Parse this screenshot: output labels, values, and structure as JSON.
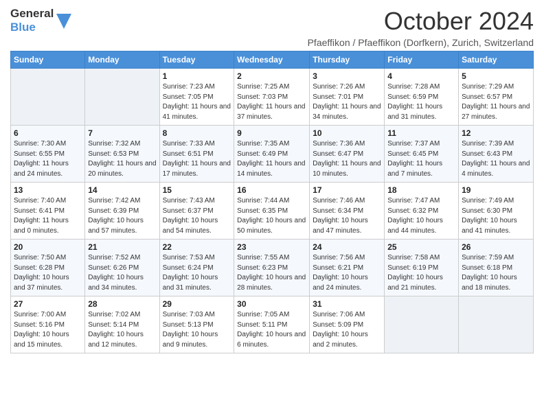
{
  "header": {
    "logo_general": "General",
    "logo_blue": "Blue",
    "title": "October 2024",
    "subtitle": "Pfaeffikon / Pfaeffikon (Dorfkern), Zurich, Switzerland"
  },
  "weekdays": [
    "Sunday",
    "Monday",
    "Tuesday",
    "Wednesday",
    "Thursday",
    "Friday",
    "Saturday"
  ],
  "weeks": [
    [
      {
        "day": "",
        "sunrise": "",
        "sunset": "",
        "daylight": ""
      },
      {
        "day": "",
        "sunrise": "",
        "sunset": "",
        "daylight": ""
      },
      {
        "day": "1",
        "sunrise": "Sunrise: 7:23 AM",
        "sunset": "Sunset: 7:05 PM",
        "daylight": "Daylight: 11 hours and 41 minutes."
      },
      {
        "day": "2",
        "sunrise": "Sunrise: 7:25 AM",
        "sunset": "Sunset: 7:03 PM",
        "daylight": "Daylight: 11 hours and 37 minutes."
      },
      {
        "day": "3",
        "sunrise": "Sunrise: 7:26 AM",
        "sunset": "Sunset: 7:01 PM",
        "daylight": "Daylight: 11 hours and 34 minutes."
      },
      {
        "day": "4",
        "sunrise": "Sunrise: 7:28 AM",
        "sunset": "Sunset: 6:59 PM",
        "daylight": "Daylight: 11 hours and 31 minutes."
      },
      {
        "day": "5",
        "sunrise": "Sunrise: 7:29 AM",
        "sunset": "Sunset: 6:57 PM",
        "daylight": "Daylight: 11 hours and 27 minutes."
      }
    ],
    [
      {
        "day": "6",
        "sunrise": "Sunrise: 7:30 AM",
        "sunset": "Sunset: 6:55 PM",
        "daylight": "Daylight: 11 hours and 24 minutes."
      },
      {
        "day": "7",
        "sunrise": "Sunrise: 7:32 AM",
        "sunset": "Sunset: 6:53 PM",
        "daylight": "Daylight: 11 hours and 20 minutes."
      },
      {
        "day": "8",
        "sunrise": "Sunrise: 7:33 AM",
        "sunset": "Sunset: 6:51 PM",
        "daylight": "Daylight: 11 hours and 17 minutes."
      },
      {
        "day": "9",
        "sunrise": "Sunrise: 7:35 AM",
        "sunset": "Sunset: 6:49 PM",
        "daylight": "Daylight: 11 hours and 14 minutes."
      },
      {
        "day": "10",
        "sunrise": "Sunrise: 7:36 AM",
        "sunset": "Sunset: 6:47 PM",
        "daylight": "Daylight: 11 hours and 10 minutes."
      },
      {
        "day": "11",
        "sunrise": "Sunrise: 7:37 AM",
        "sunset": "Sunset: 6:45 PM",
        "daylight": "Daylight: 11 hours and 7 minutes."
      },
      {
        "day": "12",
        "sunrise": "Sunrise: 7:39 AM",
        "sunset": "Sunset: 6:43 PM",
        "daylight": "Daylight: 11 hours and 4 minutes."
      }
    ],
    [
      {
        "day": "13",
        "sunrise": "Sunrise: 7:40 AM",
        "sunset": "Sunset: 6:41 PM",
        "daylight": "Daylight: 11 hours and 0 minutes."
      },
      {
        "day": "14",
        "sunrise": "Sunrise: 7:42 AM",
        "sunset": "Sunset: 6:39 PM",
        "daylight": "Daylight: 10 hours and 57 minutes."
      },
      {
        "day": "15",
        "sunrise": "Sunrise: 7:43 AM",
        "sunset": "Sunset: 6:37 PM",
        "daylight": "Daylight: 10 hours and 54 minutes."
      },
      {
        "day": "16",
        "sunrise": "Sunrise: 7:44 AM",
        "sunset": "Sunset: 6:35 PM",
        "daylight": "Daylight: 10 hours and 50 minutes."
      },
      {
        "day": "17",
        "sunrise": "Sunrise: 7:46 AM",
        "sunset": "Sunset: 6:34 PM",
        "daylight": "Daylight: 10 hours and 47 minutes."
      },
      {
        "day": "18",
        "sunrise": "Sunrise: 7:47 AM",
        "sunset": "Sunset: 6:32 PM",
        "daylight": "Daylight: 10 hours and 44 minutes."
      },
      {
        "day": "19",
        "sunrise": "Sunrise: 7:49 AM",
        "sunset": "Sunset: 6:30 PM",
        "daylight": "Daylight: 10 hours and 41 minutes."
      }
    ],
    [
      {
        "day": "20",
        "sunrise": "Sunrise: 7:50 AM",
        "sunset": "Sunset: 6:28 PM",
        "daylight": "Daylight: 10 hours and 37 minutes."
      },
      {
        "day": "21",
        "sunrise": "Sunrise: 7:52 AM",
        "sunset": "Sunset: 6:26 PM",
        "daylight": "Daylight: 10 hours and 34 minutes."
      },
      {
        "day": "22",
        "sunrise": "Sunrise: 7:53 AM",
        "sunset": "Sunset: 6:24 PM",
        "daylight": "Daylight: 10 hours and 31 minutes."
      },
      {
        "day": "23",
        "sunrise": "Sunrise: 7:55 AM",
        "sunset": "Sunset: 6:23 PM",
        "daylight": "Daylight: 10 hours and 28 minutes."
      },
      {
        "day": "24",
        "sunrise": "Sunrise: 7:56 AM",
        "sunset": "Sunset: 6:21 PM",
        "daylight": "Daylight: 10 hours and 24 minutes."
      },
      {
        "day": "25",
        "sunrise": "Sunrise: 7:58 AM",
        "sunset": "Sunset: 6:19 PM",
        "daylight": "Daylight: 10 hours and 21 minutes."
      },
      {
        "day": "26",
        "sunrise": "Sunrise: 7:59 AM",
        "sunset": "Sunset: 6:18 PM",
        "daylight": "Daylight: 10 hours and 18 minutes."
      }
    ],
    [
      {
        "day": "27",
        "sunrise": "Sunrise: 7:00 AM",
        "sunset": "Sunset: 5:16 PM",
        "daylight": "Daylight: 10 hours and 15 minutes."
      },
      {
        "day": "28",
        "sunrise": "Sunrise: 7:02 AM",
        "sunset": "Sunset: 5:14 PM",
        "daylight": "Daylight: 10 hours and 12 minutes."
      },
      {
        "day": "29",
        "sunrise": "Sunrise: 7:03 AM",
        "sunset": "Sunset: 5:13 PM",
        "daylight": "Daylight: 10 hours and 9 minutes."
      },
      {
        "day": "30",
        "sunrise": "Sunrise: 7:05 AM",
        "sunset": "Sunset: 5:11 PM",
        "daylight": "Daylight: 10 hours and 6 minutes."
      },
      {
        "day": "31",
        "sunrise": "Sunrise: 7:06 AM",
        "sunset": "Sunset: 5:09 PM",
        "daylight": "Daylight: 10 hours and 2 minutes."
      },
      {
        "day": "",
        "sunrise": "",
        "sunset": "",
        "daylight": ""
      },
      {
        "day": "",
        "sunrise": "",
        "sunset": "",
        "daylight": ""
      }
    ]
  ]
}
